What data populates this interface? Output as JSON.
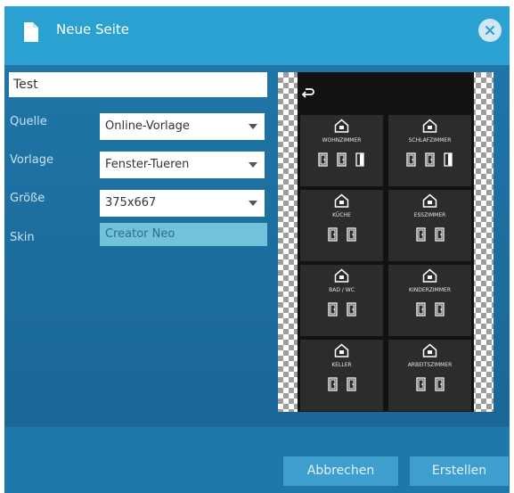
{
  "dialog": {
    "title": "Neue Seite",
    "icon": "document-icon",
    "close_icon": "close-icon"
  },
  "form": {
    "name_value": "Test",
    "quelle_label": "Quelle",
    "quelle_value": "Online-Vorlage",
    "vorlage_label": "Vorlage",
    "vorlage_value": "Fenster-Tueren",
    "groesse_label": "Größe",
    "groesse_value": "375x667",
    "skin_label": "Skin",
    "skin_value": "Creator Neo"
  },
  "preview": {
    "back_icon": "back-arrow-icon",
    "rooms": [
      {
        "label": "WOHNZIMMER",
        "icon": "sofa-icon",
        "doors": [
          "door-closed-icon",
          "door-closed-icon",
          "door-open-icon"
        ]
      },
      {
        "label": "SCHLAFZIMMER",
        "icon": "bed-icon",
        "doors": [
          "door-closed-icon",
          "door-closed-icon",
          "door-open-icon"
        ]
      },
      {
        "label": "KÜCHE",
        "icon": "kitchen-icon",
        "doors": [
          "door-closed-icon",
          "door-closed-icon"
        ]
      },
      {
        "label": "ESSZIMMER",
        "icon": "dining-icon",
        "doors": [
          "door-closed-icon",
          "door-closed-icon"
        ]
      },
      {
        "label": "BAD / WC",
        "icon": "bath-icon",
        "doors": [
          "door-closed-icon",
          "door-closed-icon"
        ]
      },
      {
        "label": "KINDERZIMMER",
        "icon": "child-room-icon",
        "doors": [
          "door-closed-icon",
          "door-closed-icon"
        ]
      },
      {
        "label": "KELLER",
        "icon": "cellar-icon",
        "doors": [
          "door-closed-icon",
          "door-closed-icon"
        ]
      },
      {
        "label": "ARBEITSZIMMER",
        "icon": "office-icon",
        "doors": [
          "door-closed-icon",
          "door-closed-icon"
        ]
      }
    ]
  },
  "buttons": {
    "cancel": "Abbrechen",
    "create": "Erstellen"
  },
  "colors": {
    "titlebar": "#2aa1d1",
    "dialog_bg": "#1d6fa0",
    "button_bg": "#3e9fcf",
    "skin_field": "#72c2db"
  }
}
